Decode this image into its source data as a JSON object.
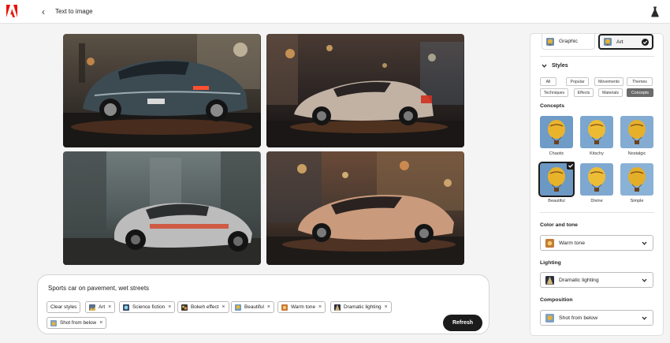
{
  "header": {
    "back_glyph": "‹",
    "title": "Text to image"
  },
  "prompt": {
    "text": "Sports car on pavement, wet streets",
    "chips": [
      {
        "label": "Clear styles",
        "thumb": false,
        "removable": false
      },
      {
        "label": "Art",
        "thumb": true,
        "removable": true
      },
      {
        "label": "Science fiction",
        "thumb": true,
        "removable": true
      },
      {
        "label": "Bokeh effect",
        "thumb": true,
        "removable": true
      },
      {
        "label": "Beautiful",
        "thumb": true,
        "removable": true
      },
      {
        "label": "Warm tone",
        "thumb": true,
        "removable": true
      },
      {
        "label": "Dramatic lighting",
        "thumb": true,
        "removable": true
      },
      {
        "label": "Shot from below",
        "thumb": true,
        "removable": true
      }
    ],
    "remove_glyph": "×",
    "refresh_label": "Refresh"
  },
  "panel": {
    "content_types": [
      {
        "label": "Graphic",
        "selected": false
      },
      {
        "label": "Art",
        "selected": true
      }
    ],
    "styles_heading": "Styles",
    "filter_tabs": [
      {
        "label": "All",
        "selected": false
      },
      {
        "label": "Popular",
        "selected": false
      },
      {
        "label": "Movements",
        "selected": false
      },
      {
        "label": "Themes",
        "selected": false
      },
      {
        "label": "Techniques",
        "selected": false
      },
      {
        "label": "Effects",
        "selected": false
      },
      {
        "label": "Materials",
        "selected": false
      },
      {
        "label": "Concepts",
        "selected": true
      }
    ],
    "concepts_label": "Concepts",
    "concepts": [
      {
        "label": "Chaotic",
        "selected": false
      },
      {
        "label": "Kitschy",
        "selected": false
      },
      {
        "label": "Nostalgic",
        "selected": false
      },
      {
        "label": "Beautiful",
        "selected": true
      },
      {
        "label": "Divine",
        "selected": false
      },
      {
        "label": "Simple",
        "selected": false
      }
    ],
    "color_tone": {
      "label": "Color and tone",
      "value": "Warm tone"
    },
    "lighting": {
      "label": "Lighting",
      "value": "Dramatic lighting"
    },
    "composition": {
      "label": "Composition",
      "value": "Shot from below"
    }
  },
  "colors": {
    "brand_red": "#eb1000",
    "selected_border": "#1d1d1d",
    "refresh_bg": "#1b1b1b",
    "page_bg": "#f4f4f4",
    "selected_tab_bg": "#6b6b6b"
  }
}
